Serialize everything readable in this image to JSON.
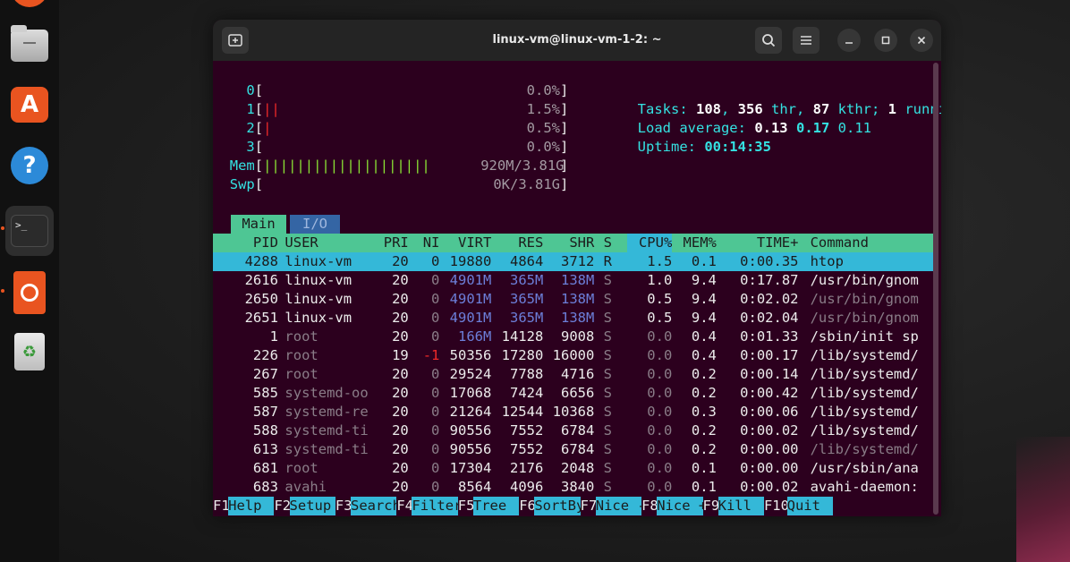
{
  "window": {
    "title": "linux-vm@linux-vm-1-2: ~"
  },
  "meters": {
    "cpus": [
      {
        "label": "0",
        "bars": "",
        "percent": "0.0%"
      },
      {
        "label": "1",
        "bars": "||",
        "percent": "1.5%"
      },
      {
        "label": "2",
        "bars": "|",
        "percent": "0.5%"
      },
      {
        "label": "3",
        "bars": "",
        "percent": "0.0%"
      }
    ],
    "mem": {
      "label": "Mem",
      "bars": "||||||||||||||||||||",
      "value": "920M/3.81G"
    },
    "swp": {
      "label": "Swp",
      "bars": "",
      "value": "0K/3.81G"
    }
  },
  "summary": {
    "tasks_label": "Tasks: ",
    "tasks": "108",
    "thr": "356",
    "thr_label": " thr, ",
    "kthr": "87",
    "kthr_label": " kthr; ",
    "running": "1",
    "running_label": " runnin",
    "load_label": "Load average: ",
    "load1": "0.13",
    "load5": "0.17",
    "load15": "0.11",
    "uptime_label": "Uptime: ",
    "uptime": "00:14:35"
  },
  "tabs": [
    {
      "label": "Main"
    },
    {
      "label": "I/O"
    }
  ],
  "columns": [
    "PID",
    "USER",
    "PRI",
    "NI",
    "VIRT",
    "RES",
    "SHR",
    "S",
    "CPU%",
    "MEM%",
    "TIME+",
    "Command"
  ],
  "processes": [
    {
      "pid": "4288",
      "user": "linux-vm",
      "pri": "20",
      "ni": "0",
      "virt": "19880",
      "res": "4864",
      "shr": "3712",
      "s": "R",
      "cpu": "1.5",
      "mem": "0.1",
      "time": "0:00.35",
      "cmd": "htop"
    },
    {
      "pid": "2616",
      "user": "linux-vm",
      "pri": "20",
      "ni": "0",
      "virt": "4901M",
      "res": "365M",
      "shr": "138M",
      "s": "S",
      "cpu": "1.0",
      "mem": "9.4",
      "time": "0:17.87",
      "cmd": "/usr/bin/gnom"
    },
    {
      "pid": "2650",
      "user": "linux-vm",
      "pri": "20",
      "ni": "0",
      "virt": "4901M",
      "res": "365M",
      "shr": "138M",
      "s": "S",
      "cpu": "0.5",
      "mem": "9.4",
      "time": "0:02.02",
      "cmd": "/usr/bin/gnom"
    },
    {
      "pid": "2651",
      "user": "linux-vm",
      "pri": "20",
      "ni": "0",
      "virt": "4901M",
      "res": "365M",
      "shr": "138M",
      "s": "S",
      "cpu": "0.5",
      "mem": "9.4",
      "time": "0:02.04",
      "cmd": "/usr/bin/gnom"
    },
    {
      "pid": "1",
      "user": "root",
      "pri": "20",
      "ni": "0",
      "virt": "166M",
      "res": "14128",
      "shr": "9008",
      "s": "S",
      "cpu": "0.0",
      "mem": "0.4",
      "time": "0:01.33",
      "cmd": "/sbin/init sp"
    },
    {
      "pid": "226",
      "user": "root",
      "pri": "19",
      "ni": "-1",
      "virt": "50356",
      "res": "17280",
      "shr": "16000",
      "s": "S",
      "cpu": "0.0",
      "mem": "0.4",
      "time": "0:00.17",
      "cmd": "/lib/systemd/"
    },
    {
      "pid": "267",
      "user": "root",
      "pri": "20",
      "ni": "0",
      "virt": "29524",
      "res": "7788",
      "shr": "4716",
      "s": "S",
      "cpu": "0.0",
      "mem": "0.2",
      "time": "0:00.14",
      "cmd": "/lib/systemd/"
    },
    {
      "pid": "585",
      "user": "systemd-oo",
      "pri": "20",
      "ni": "0",
      "virt": "17068",
      "res": "7424",
      "shr": "6656",
      "s": "S",
      "cpu": "0.0",
      "mem": "0.2",
      "time": "0:00.42",
      "cmd": "/lib/systemd/"
    },
    {
      "pid": "587",
      "user": "systemd-re",
      "pri": "20",
      "ni": "0",
      "virt": "21264",
      "res": "12544",
      "shr": "10368",
      "s": "S",
      "cpu": "0.0",
      "mem": "0.3",
      "time": "0:00.06",
      "cmd": "/lib/systemd/"
    },
    {
      "pid": "588",
      "user": "systemd-ti",
      "pri": "20",
      "ni": "0",
      "virt": "90556",
      "res": "7552",
      "shr": "6784",
      "s": "S",
      "cpu": "0.0",
      "mem": "0.2",
      "time": "0:00.02",
      "cmd": "/lib/systemd/"
    },
    {
      "pid": "613",
      "user": "systemd-ti",
      "pri": "20",
      "ni": "0",
      "virt": "90556",
      "res": "7552",
      "shr": "6784",
      "s": "S",
      "cpu": "0.0",
      "mem": "0.2",
      "time": "0:00.00",
      "cmd": "/lib/systemd/"
    },
    {
      "pid": "681",
      "user": "root",
      "pri": "20",
      "ni": "0",
      "virt": "17304",
      "res": "2176",
      "shr": "2048",
      "s": "S",
      "cpu": "0.0",
      "mem": "0.1",
      "time": "0:00.00",
      "cmd": "/usr/sbin/ana"
    },
    {
      "pid": "683",
      "user": "avahi",
      "pri": "20",
      "ni": "0",
      "virt": "8564",
      "res": "4096",
      "shr": "3840",
      "s": "S",
      "cpu": "0.0",
      "mem": "0.1",
      "time": "0:00.02",
      "cmd": "avahi-daemon:"
    }
  ],
  "function_keys": [
    {
      "key": "F1",
      "label": "Help  "
    },
    {
      "key": "F2",
      "label": "Setup "
    },
    {
      "key": "F3",
      "label": "Search"
    },
    {
      "key": "F4",
      "label": "Filter"
    },
    {
      "key": "F5",
      "label": "Tree  "
    },
    {
      "key": "F6",
      "label": "SortBy"
    },
    {
      "key": "F7",
      "label": "Nice -"
    },
    {
      "key": "F8",
      "label": "Nice +"
    },
    {
      "key": "F9",
      "label": "Kill  "
    },
    {
      "key": "F10",
      "label": "Quit"
    }
  ],
  "colors": {
    "terminal_bg": "#2c001e",
    "header_green": "#4ec694",
    "selection_cyan": "#34b8d8",
    "ubuntu_orange": "#e95420"
  }
}
